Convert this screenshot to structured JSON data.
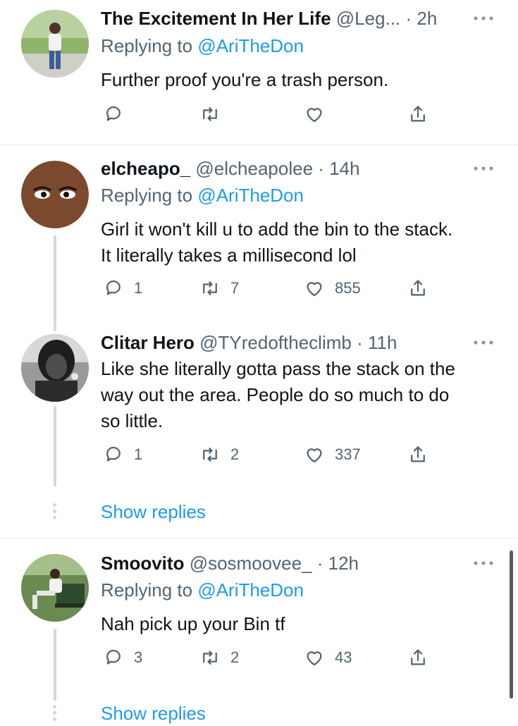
{
  "tweets": [
    {
      "name": "The Excitement In Her Life",
      "handle": "@Leg...",
      "time": "2h",
      "reply_label": "Replying to",
      "reply_mention": "@AriTheDon",
      "text": "Further proof you're a trash person.",
      "replies": "",
      "retweets": "",
      "likes": ""
    },
    {
      "name": "elcheapo_",
      "handle": "@elcheapolee",
      "time": "14h",
      "reply_label": "Replying to",
      "reply_mention": "@AriTheDon",
      "text_lines": [
        "Girl it won't kill u to add the bin to the stack.",
        "It literally takes a millisecond lol"
      ],
      "replies": "1",
      "retweets": "7",
      "likes": "855"
    },
    {
      "name": "Clitar Hero",
      "handle": "@TYredoftheclimb",
      "time": "11h",
      "text_lines": [
        "Like she literally gotta pass the stack on the",
        "way out the area. People do so much to do",
        "so little."
      ],
      "replies": "1",
      "retweets": "2",
      "likes": "337"
    },
    {
      "name": "Smoovito",
      "handle": "@sosmoovee_",
      "time": "12h",
      "reply_label": "Replying to",
      "reply_mention": "@AriTheDon",
      "text": "Nah pick up your Bin tf",
      "replies": "3",
      "retweets": "2",
      "likes": "43"
    }
  ],
  "show_replies_label": "Show replies",
  "separator": "·",
  "icons": {
    "reply": "reply-icon",
    "retweet": "retweet-icon",
    "like": "heart-icon",
    "share": "share-icon",
    "more": "more-icon"
  },
  "colors": {
    "link": "#1d9bf0",
    "secondary": "#536471",
    "thread_line": "#cfd9de"
  }
}
